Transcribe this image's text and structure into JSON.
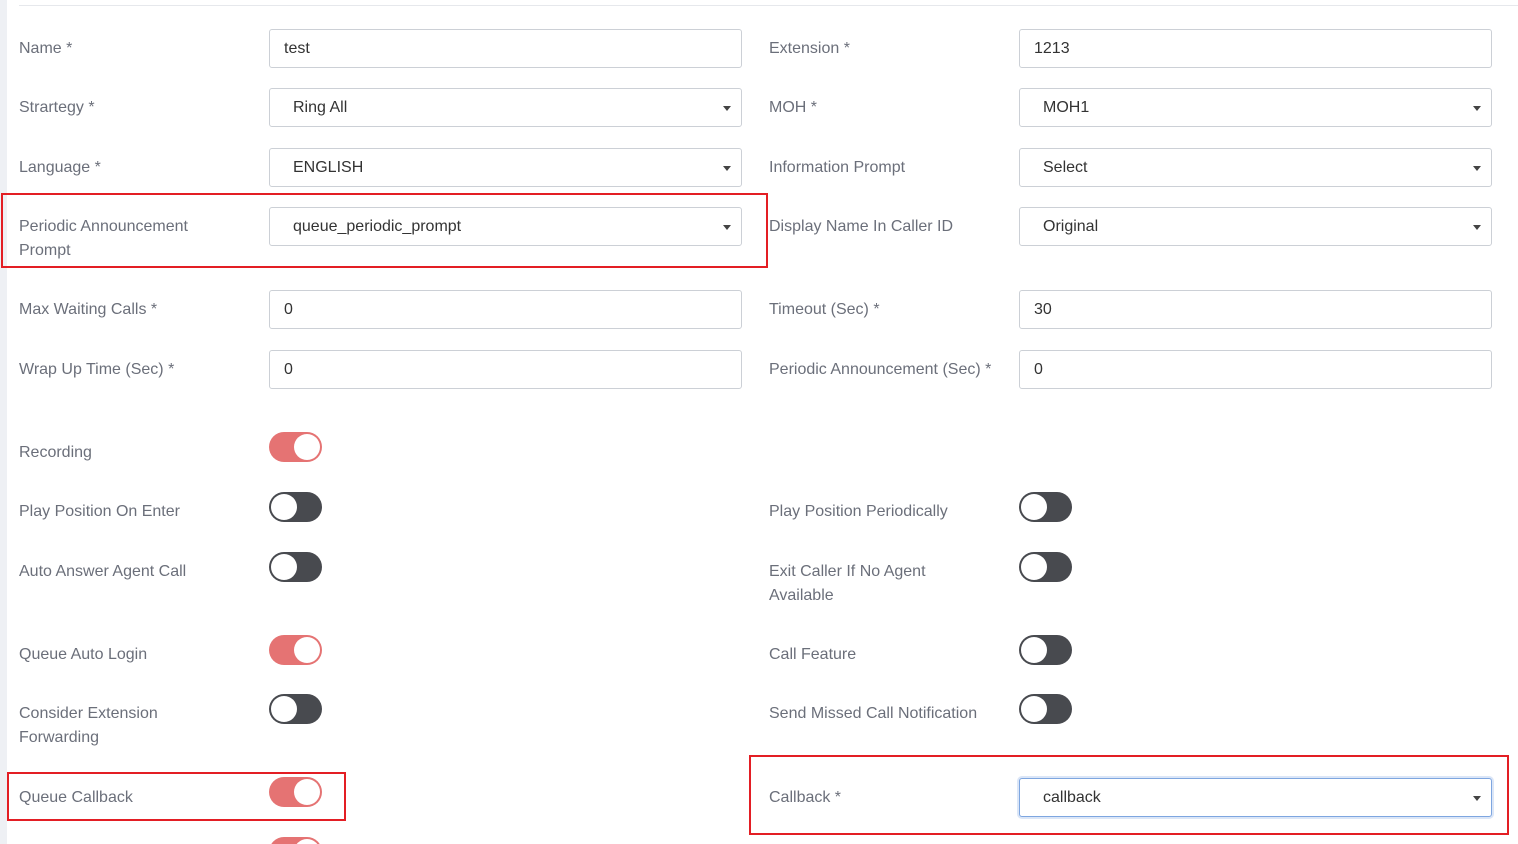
{
  "fields": {
    "name": {
      "label": "Name *",
      "value": "test"
    },
    "extension": {
      "label": "Extension *",
      "value": "1213"
    },
    "strategy": {
      "label": "Strartegy *",
      "value": "Ring All"
    },
    "moh": {
      "label": "MOH *",
      "value": "MOH1"
    },
    "language": {
      "label": "Language *",
      "value": "ENGLISH"
    },
    "information_prompt": {
      "label": "Information Prompt",
      "value": "Select"
    },
    "periodic_announcement_prompt": {
      "label": "Periodic Announcement Prompt",
      "value": "queue_periodic_prompt"
    },
    "display_name_caller_id": {
      "label": "Display Name In Caller ID",
      "value": "Original"
    },
    "max_waiting_calls": {
      "label": "Max Waiting Calls *",
      "value": "0"
    },
    "timeout": {
      "label": "Timeout (Sec) *",
      "value": "30"
    },
    "wrap_up_time": {
      "label": "Wrap Up Time (Sec) *",
      "value": "0"
    },
    "periodic_announcement_sec": {
      "label": "Periodic Announcement (Sec) *",
      "value": "0"
    },
    "callback": {
      "label": "Callback *",
      "value": "callback"
    }
  },
  "toggles": {
    "recording": {
      "label": "Recording",
      "on": true
    },
    "play_position_on_enter": {
      "label": "Play Position On Enter",
      "on": false
    },
    "play_position_periodically": {
      "label": "Play Position Periodically",
      "on": false
    },
    "auto_answer_agent_call": {
      "label": "Auto Answer Agent Call",
      "on": false
    },
    "exit_caller_no_agent": {
      "label": "Exit Caller If No Agent Available",
      "on": false
    },
    "queue_auto_login": {
      "label": "Queue Auto Login",
      "on": true
    },
    "call_feature": {
      "label": "Call Feature",
      "on": false
    },
    "consider_extension_forwarding": {
      "label": "Consider Extension Forwarding",
      "on": false
    },
    "send_missed_call_notification": {
      "label": "Send Missed Call Notification",
      "on": false
    },
    "queue_callback": {
      "label": "Queue Callback",
      "on": true
    },
    "next_partial": {
      "on": true
    }
  },
  "colors": {
    "toggle_on": "#e57373",
    "toggle_off": "#484a4f",
    "highlight": "#e31e24"
  }
}
